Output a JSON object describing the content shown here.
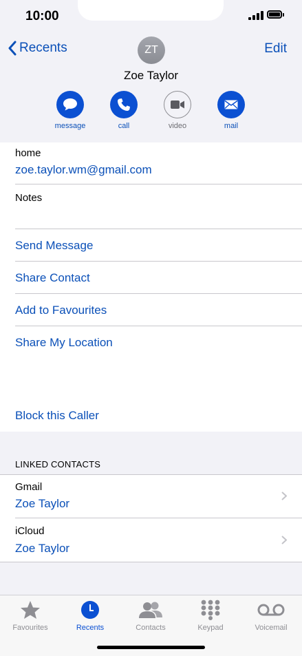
{
  "status": {
    "time": "10:00"
  },
  "header": {
    "back_label": "Recents",
    "edit_label": "Edit",
    "avatar_initials": "ZT",
    "contact_name": "Zoe Taylor"
  },
  "actions": [
    {
      "label": "message",
      "icon": "message-bubble-icon"
    },
    {
      "label": "call",
      "icon": "phone-icon"
    },
    {
      "label": "video",
      "icon": "video-camera-icon"
    },
    {
      "label": "mail",
      "icon": "envelope-icon"
    }
  ],
  "email": {
    "label": "home",
    "value": "zoe.taylor.wm@gmail.com"
  },
  "notes": {
    "label": "Notes"
  },
  "options": {
    "send_message": "Send Message",
    "share_contact": "Share Contact",
    "add_favourites": "Add to Favourites",
    "share_location": "Share My Location",
    "block_caller": "Block this Caller"
  },
  "linked": {
    "title": "LINKED CONTACTS",
    "items": [
      {
        "source": "Gmail",
        "name": "Zoe Taylor"
      },
      {
        "source": "iCloud",
        "name": "Zoe Taylor"
      }
    ]
  },
  "tabbar": {
    "active": "Recents",
    "tabs": [
      {
        "label": "Favourites",
        "icon": "star-icon"
      },
      {
        "label": "Recents",
        "icon": "clock-icon"
      },
      {
        "label": "Contacts",
        "icon": "people-icon"
      },
      {
        "label": "Keypad",
        "icon": "keypad-icon"
      },
      {
        "label": "Voicemail",
        "icon": "voicemail-icon"
      }
    ]
  },
  "colors": {
    "accent": "#0b50d2",
    "link": "#0b50b8",
    "header_bg": "#f2f2f7"
  }
}
